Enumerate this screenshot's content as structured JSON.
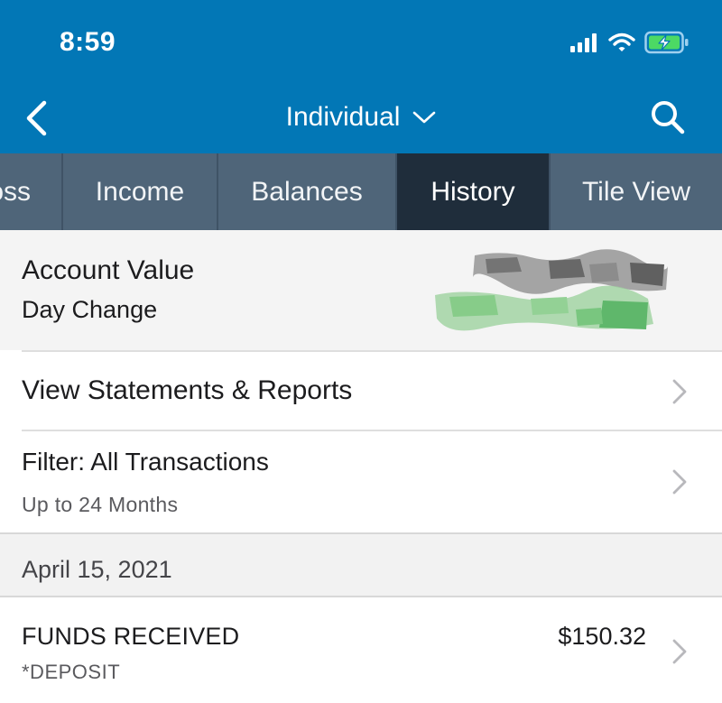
{
  "status_bar": {
    "time": "8:59",
    "icons": [
      "signal-icon",
      "wifi-icon",
      "battery-charging-icon"
    ]
  },
  "nav": {
    "title": "Individual",
    "icons": [
      "back-chevron-icon",
      "chevron-down-icon",
      "search-icon"
    ]
  },
  "tabs": [
    {
      "label": "oss",
      "active": false
    },
    {
      "label": "Income",
      "active": false
    },
    {
      "label": "Balances",
      "active": false
    },
    {
      "label": "History",
      "active": true
    },
    {
      "label": "Tile View",
      "active": false
    }
  ],
  "account": {
    "value_label": "Account Value",
    "day_change_label": "Day Change"
  },
  "statements": {
    "label": "View Statements & Reports"
  },
  "filter": {
    "label": "Filter: All Transactions",
    "range": "Up to 24 Months"
  },
  "history": {
    "date": "April 15, 2021",
    "transactions": [
      {
        "title": "FUNDS RECEIVED",
        "subtitle": "*DEPOSIT",
        "amount": "$150.32"
      }
    ]
  },
  "colors": {
    "header_blue": "#0277b6",
    "tab_bar": "#4f6579",
    "tab_active": "#1f2d3b",
    "gain_green": "#3aa84a"
  }
}
